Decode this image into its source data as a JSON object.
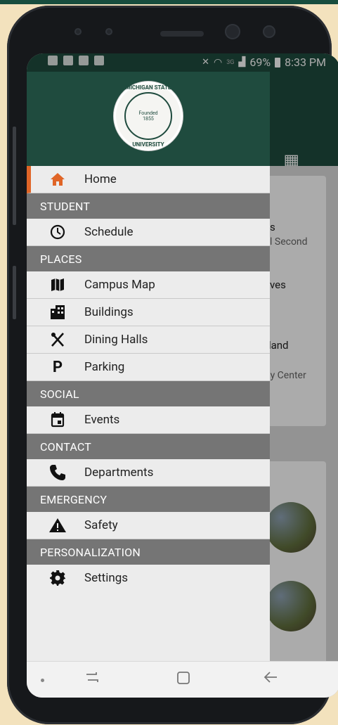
{
  "status_bar": {
    "battery": "69%",
    "time": "8:33 PM",
    "network": "3G"
  },
  "drawer": {
    "logo": {
      "ring_top": "MICHIGAN STATE",
      "ring_bottom": "UNIVERSITY",
      "founded": "Founded",
      "year": "1855"
    },
    "home": {
      "label": "Home",
      "icon": "home-icon"
    },
    "sections": [
      {
        "title": "STUDENT",
        "items": [
          {
            "label": "Schedule",
            "icon": "clock-icon"
          }
        ]
      },
      {
        "title": "PLACES",
        "items": [
          {
            "label": "Campus Map",
            "icon": "map-icon"
          },
          {
            "label": "Buildings",
            "icon": "building-icon"
          },
          {
            "label": "Dining Halls",
            "icon": "utensils-icon"
          },
          {
            "label": "Parking",
            "icon": "parking-icon"
          }
        ]
      },
      {
        "title": "SOCIAL",
        "items": [
          {
            "label": "Events",
            "icon": "calendar-icon"
          }
        ]
      },
      {
        "title": "CONTACT",
        "items": [
          {
            "label": "Departments",
            "icon": "phone-icon"
          }
        ]
      },
      {
        "title": "EMERGENCY",
        "items": [
          {
            "label": "Safety",
            "icon": "warning-icon"
          }
        ]
      },
      {
        "title": "PERSONALIZATION",
        "items": [
          {
            "label": "Settings",
            "icon": "gear-icon"
          }
        ]
      }
    ]
  },
  "background_content": {
    "snippet1": "s",
    "snippet1_sub": "l Second",
    "snippet2": "ves",
    "snippet3": "eland",
    "snippet3_sub": "ty Center"
  },
  "colors": {
    "brand_green": "#1f4b3e",
    "accent_orange": "#e06527",
    "section_gray": "#757575"
  }
}
